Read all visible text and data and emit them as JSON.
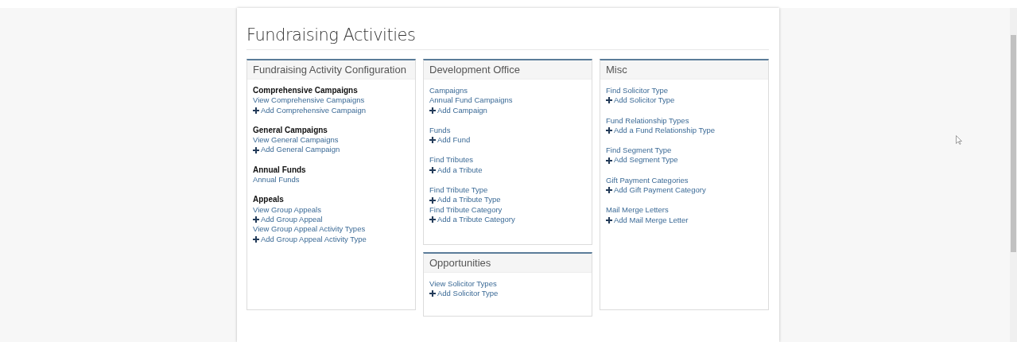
{
  "page": {
    "title": "Fundraising Activities"
  },
  "columns": [
    {
      "panels": [
        {
          "title": "Fundraising Activity Configuration",
          "groups": [
            {
              "heading": "Comprehensive Campaigns",
              "links": [
                {
                  "kind": "view",
                  "label": "View Comprehensive Campaigns"
                },
                {
                  "kind": "add",
                  "label": "Add Comprehensive Campaign"
                }
              ]
            },
            {
              "heading": "General Campaigns",
              "links": [
                {
                  "kind": "view",
                  "label": "View General Campaigns"
                },
                {
                  "kind": "add",
                  "label": "Add General Campaign"
                }
              ]
            },
            {
              "heading": "Annual Funds",
              "links": [
                {
                  "kind": "view",
                  "label": "Annual Funds"
                }
              ]
            },
            {
              "heading": "Appeals",
              "links": [
                {
                  "kind": "view",
                  "label": "View Group Appeals"
                },
                {
                  "kind": "add",
                  "label": "Add Group Appeal"
                },
                {
                  "kind": "view",
                  "label": "View Group Appeal Activity Types"
                },
                {
                  "kind": "add",
                  "label": "Add Group Appeal Activity Type"
                }
              ]
            }
          ]
        }
      ]
    },
    {
      "panels": [
        {
          "title": "Development Office",
          "groups": [
            {
              "links": [
                {
                  "kind": "view",
                  "label": "Campaigns"
                },
                {
                  "kind": "view",
                  "label": "Annual Fund Campaigns"
                },
                {
                  "kind": "add",
                  "label": "Add Campaign"
                }
              ]
            },
            {
              "links": [
                {
                  "kind": "view",
                  "label": "Funds"
                },
                {
                  "kind": "add",
                  "label": "Add Fund"
                }
              ]
            },
            {
              "links": [
                {
                  "kind": "view",
                  "label": "Find Tributes"
                },
                {
                  "kind": "add",
                  "label": "Add a Tribute"
                }
              ]
            },
            {
              "links": [
                {
                  "kind": "view",
                  "label": "Find Tribute Type"
                },
                {
                  "kind": "add",
                  "label": "Add a Tribute Type"
                },
                {
                  "kind": "view",
                  "label": "Find Tribute Category"
                },
                {
                  "kind": "add",
                  "label": "Add a Tribute Category"
                }
              ]
            }
          ]
        },
        {
          "title": "Opportunities",
          "groups": [
            {
              "links": [
                {
                  "kind": "view",
                  "label": "View Solicitor Types"
                },
                {
                  "kind": "add",
                  "label": "Add Solicitor Type"
                }
              ]
            }
          ]
        }
      ]
    },
    {
      "panels": [
        {
          "title": "Misc",
          "groups": [
            {
              "links": [
                {
                  "kind": "view",
                  "label": "Find Solicitor Type"
                },
                {
                  "kind": "add",
                  "label": "Add Solicitor Type"
                }
              ]
            },
            {
              "links": [
                {
                  "kind": "view",
                  "label": "Fund Relationship Types"
                },
                {
                  "kind": "add",
                  "label": "Add a Fund Relationship Type"
                }
              ]
            },
            {
              "links": [
                {
                  "kind": "view",
                  "label": "Find Segment Type"
                },
                {
                  "kind": "add",
                  "label": "Add Segment Type"
                }
              ]
            },
            {
              "links": [
                {
                  "kind": "view",
                  "label": "Gift Payment Categories"
                },
                {
                  "kind": "add",
                  "label": "Add Gift Payment Category"
                }
              ]
            },
            {
              "links": [
                {
                  "kind": "view",
                  "label": "Mail Merge Letters"
                },
                {
                  "kind": "add",
                  "label": "Add Mail Merge Letter"
                }
              ]
            }
          ]
        }
      ]
    }
  ]
}
